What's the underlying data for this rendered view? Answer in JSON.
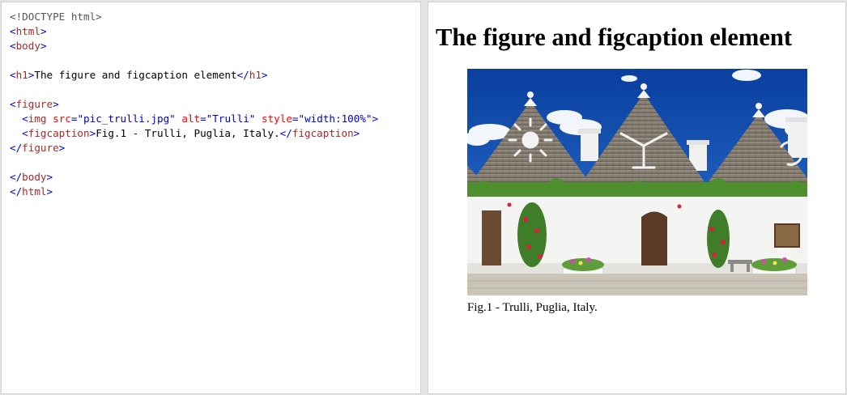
{
  "code_editor": {
    "lines": [
      [
        {
          "t": "doctype",
          "v": "<!DOCTYPE html>"
        }
      ],
      [
        {
          "t": "bracket",
          "v": "<"
        },
        {
          "t": "tag",
          "v": "html"
        },
        {
          "t": "bracket",
          "v": ">"
        }
      ],
      [
        {
          "t": "bracket",
          "v": "<"
        },
        {
          "t": "tag",
          "v": "body"
        },
        {
          "t": "bracket",
          "v": ">"
        }
      ],
      [],
      [
        {
          "t": "bracket",
          "v": "<"
        },
        {
          "t": "tag",
          "v": "h1"
        },
        {
          "t": "bracket",
          "v": ">"
        },
        {
          "t": "text",
          "v": "The figure and figcaption element"
        },
        {
          "t": "bracket",
          "v": "</"
        },
        {
          "t": "tag",
          "v": "h1"
        },
        {
          "t": "bracket",
          "v": ">"
        }
      ],
      [],
      [
        {
          "t": "bracket",
          "v": "<"
        },
        {
          "t": "tag",
          "v": "figure"
        },
        {
          "t": "bracket",
          "v": ">"
        }
      ],
      [
        {
          "t": "text",
          "v": "  "
        },
        {
          "t": "bracket",
          "v": "<"
        },
        {
          "t": "tag",
          "v": "img"
        },
        {
          "t": "text",
          "v": " "
        },
        {
          "t": "attr",
          "v": "src"
        },
        {
          "t": "bracket",
          "v": "="
        },
        {
          "t": "value",
          "v": "\"pic_trulli.jpg\""
        },
        {
          "t": "text",
          "v": " "
        },
        {
          "t": "attr",
          "v": "alt"
        },
        {
          "t": "bracket",
          "v": "="
        },
        {
          "t": "value",
          "v": "\"Trulli\""
        },
        {
          "t": "text",
          "v": " "
        },
        {
          "t": "attr",
          "v": "style"
        },
        {
          "t": "bracket",
          "v": "="
        },
        {
          "t": "value",
          "v": "\"width:100%\""
        },
        {
          "t": "bracket",
          "v": ">"
        }
      ],
      [
        {
          "t": "text",
          "v": "  "
        },
        {
          "t": "bracket",
          "v": "<"
        },
        {
          "t": "tag",
          "v": "figcaption"
        },
        {
          "t": "bracket",
          "v": ">"
        },
        {
          "t": "text",
          "v": "Fig.1 - Trulli, Puglia, Italy."
        },
        {
          "t": "bracket",
          "v": "</"
        },
        {
          "t": "tag",
          "v": "figcaption"
        },
        {
          "t": "bracket",
          "v": ">"
        }
      ],
      [
        {
          "t": "bracket",
          "v": "</"
        },
        {
          "t": "tag",
          "v": "figure"
        },
        {
          "t": "bracket",
          "v": ">"
        }
      ],
      [],
      [
        {
          "t": "bracket",
          "v": "</"
        },
        {
          "t": "tag",
          "v": "body"
        },
        {
          "t": "bracket",
          "v": ">"
        }
      ],
      [
        {
          "t": "bracket",
          "v": "</"
        },
        {
          "t": "tag",
          "v": "html"
        },
        {
          "t": "bracket",
          "v": ">"
        }
      ]
    ]
  },
  "result": {
    "heading": "The figure and figcaption element",
    "image_alt": "Trulli",
    "caption": "Fig.1 - Trulli, Puglia, Italy."
  },
  "colors": {
    "tag": "#a52a2a",
    "bracket": "#0000cd",
    "attr": "#ff0000",
    "value": "#0000cd",
    "doctype": "#555555",
    "pane_border": "#d3d3d3",
    "splitter": "#e3e3e3"
  }
}
